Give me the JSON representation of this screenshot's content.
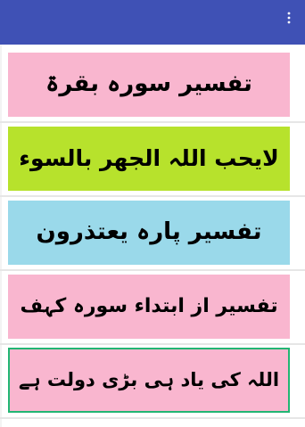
{
  "app_bar": {
    "color": "#3f51b5",
    "menu_icon": "more-vert-icon"
  },
  "items": [
    {
      "label": "تفسیر سورہ بقرۃ",
      "background": "#f9b6cf"
    },
    {
      "label": "لایحب اللہ الجھر بالسوء",
      "background": "#b7e22c"
    },
    {
      "label": "تفسیر پارہ یعتذرون",
      "background": "#9ad9ea"
    },
    {
      "label": "تفسیر از ابتداء سورہ کہف",
      "background": "#f9b6cf"
    },
    {
      "label": "اللہ کی یاد ہی بڑی دولت ہے",
      "background": "#f9b6cf",
      "border": "#22b573"
    }
  ]
}
